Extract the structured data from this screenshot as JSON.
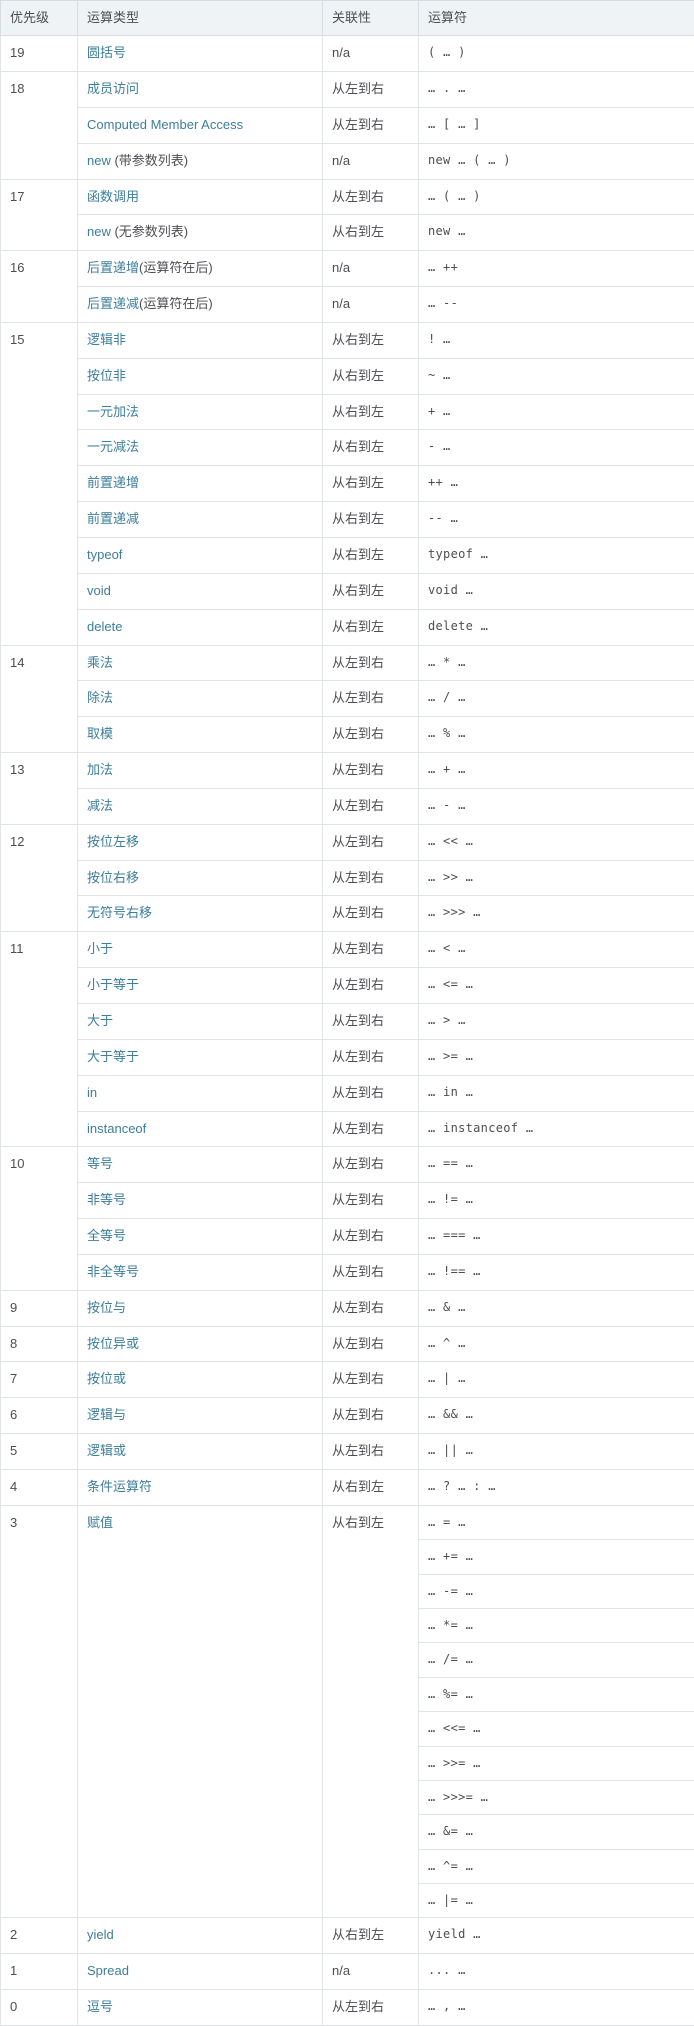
{
  "table": {
    "headers": [
      "优先级",
      "运算类型",
      "关联性",
      "运算符"
    ],
    "assoc": {
      "na": "n/a",
      "ltr": "从左到右",
      "rtl": "从右到左"
    },
    "rows": [
      {
        "precedence": "19",
        "precedence_rowspan": 1,
        "type_link": "圆括号",
        "type_note": "",
        "assoc": "n/a",
        "operator": "( … )"
      },
      {
        "precedence": "18",
        "precedence_rowspan": 3,
        "type_link": "成员访问",
        "type_note": "",
        "assoc": "从左到右",
        "operator": "… . …"
      },
      {
        "precedence": "",
        "precedence_rowspan": 0,
        "type_link": "Computed Member Access",
        "type_note": "",
        "assoc": "从左到右",
        "operator": "… [ … ]"
      },
      {
        "precedence": "",
        "precedence_rowspan": 0,
        "type_link": "new",
        "type_note": " (带参数列表)",
        "assoc": "n/a",
        "operator": "new … ( … )"
      },
      {
        "precedence": "17",
        "precedence_rowspan": 2,
        "type_link": "函数调用",
        "type_note": "",
        "assoc": "从左到右",
        "operator": "… ( … )"
      },
      {
        "precedence": "",
        "precedence_rowspan": 0,
        "type_link": "new",
        "type_note": " (无参数列表)",
        "assoc": "从右到左",
        "operator": "new …"
      },
      {
        "precedence": "16",
        "precedence_rowspan": 2,
        "type_link": "后置递增",
        "type_note": "(运算符在后)",
        "assoc": "n/a",
        "operator": "… ++"
      },
      {
        "precedence": "",
        "precedence_rowspan": 0,
        "type_link": "后置递减",
        "type_note": "(运算符在后)",
        "assoc": "n/a",
        "operator": "… --"
      },
      {
        "precedence": "15",
        "precedence_rowspan": 9,
        "type_link": "逻辑非",
        "type_note": "",
        "assoc": "从右到左",
        "operator": "! …"
      },
      {
        "precedence": "",
        "precedence_rowspan": 0,
        "type_link": "按位非",
        "type_note": "",
        "assoc": "从右到左",
        "operator": "~ …"
      },
      {
        "precedence": "",
        "precedence_rowspan": 0,
        "type_link": "一元加法",
        "type_note": "",
        "assoc": "从右到左",
        "operator": "+ …"
      },
      {
        "precedence": "",
        "precedence_rowspan": 0,
        "type_link": "一元减法",
        "type_note": "",
        "assoc": "从右到左",
        "operator": "- …"
      },
      {
        "precedence": "",
        "precedence_rowspan": 0,
        "type_link": "前置递增",
        "type_note": "",
        "assoc": "从右到左",
        "operator": "++ …"
      },
      {
        "precedence": "",
        "precedence_rowspan": 0,
        "type_link": "前置递减",
        "type_note": "",
        "assoc": "从右到左",
        "operator": "-- …"
      },
      {
        "precedence": "",
        "precedence_rowspan": 0,
        "type_link": "typeof",
        "type_note": "",
        "assoc": "从右到左",
        "operator": "typeof …"
      },
      {
        "precedence": "",
        "precedence_rowspan": 0,
        "type_link": "void",
        "type_note": "",
        "assoc": "从右到左",
        "operator": "void …"
      },
      {
        "precedence": "",
        "precedence_rowspan": 0,
        "type_link": "delete",
        "type_note": "",
        "assoc": "从右到左",
        "operator": "delete …"
      },
      {
        "precedence": "14",
        "precedence_rowspan": 3,
        "type_link": "乘法",
        "type_note": "",
        "assoc": "从左到右",
        "operator": "… * …"
      },
      {
        "precedence": "",
        "precedence_rowspan": 0,
        "type_link": "除法",
        "type_note": "",
        "assoc": "从左到右",
        "operator": "… / …"
      },
      {
        "precedence": "",
        "precedence_rowspan": 0,
        "type_link": "取模",
        "type_note": "",
        "assoc": "从左到右",
        "operator": "… % …"
      },
      {
        "precedence": "13",
        "precedence_rowspan": 2,
        "type_link": "加法",
        "type_note": "",
        "assoc": "从左到右",
        "operator": "… + …"
      },
      {
        "precedence": "",
        "precedence_rowspan": 0,
        "type_link": "减法",
        "type_note": "",
        "assoc": "从左到右",
        "operator": "… - …"
      },
      {
        "precedence": "12",
        "precedence_rowspan": 3,
        "type_link": "按位左移",
        "type_note": "",
        "assoc": "从左到右",
        "operator": "… << …"
      },
      {
        "precedence": "",
        "precedence_rowspan": 0,
        "type_link": "按位右移",
        "type_note": "",
        "assoc": "从左到右",
        "operator": "… >> …"
      },
      {
        "precedence": "",
        "precedence_rowspan": 0,
        "type_link": "无符号右移",
        "type_note": "",
        "assoc": "从左到右",
        "operator": "… >>> …"
      },
      {
        "precedence": "11",
        "precedence_rowspan": 6,
        "type_link": "小于",
        "type_note": "",
        "assoc": "从左到右",
        "operator": "… < …"
      },
      {
        "precedence": "",
        "precedence_rowspan": 0,
        "type_link": "小于等于",
        "type_note": "",
        "assoc": "从左到右",
        "operator": "… <= …"
      },
      {
        "precedence": "",
        "precedence_rowspan": 0,
        "type_link": "大于",
        "type_note": "",
        "assoc": "从左到右",
        "operator": "… > …"
      },
      {
        "precedence": "",
        "precedence_rowspan": 0,
        "type_link": "大于等于",
        "type_note": "",
        "assoc": "从左到右",
        "operator": "… >= …"
      },
      {
        "precedence": "",
        "precedence_rowspan": 0,
        "type_link": "in",
        "type_note": "",
        "assoc": "从左到右",
        "operator": "… in …"
      },
      {
        "precedence": "",
        "precedence_rowspan": 0,
        "type_link": "instanceof",
        "type_note": "",
        "assoc": "从左到右",
        "operator": "… instanceof …"
      },
      {
        "precedence": "10",
        "precedence_rowspan": 4,
        "type_link": "等号",
        "type_note": "",
        "assoc": "从左到右",
        "operator": "… == …"
      },
      {
        "precedence": "",
        "precedence_rowspan": 0,
        "type_link": "非等号",
        "type_note": "",
        "assoc": "从左到右",
        "operator": "… != …"
      },
      {
        "precedence": "",
        "precedence_rowspan": 0,
        "type_link": "全等号",
        "type_note": "",
        "assoc": "从左到右",
        "operator": "… === …"
      },
      {
        "precedence": "",
        "precedence_rowspan": 0,
        "type_link": "非全等号",
        "type_note": "",
        "assoc": "从左到右",
        "operator": "… !== …"
      },
      {
        "precedence": "9",
        "precedence_rowspan": 1,
        "type_link": "按位与",
        "type_note": "",
        "assoc": "从左到右",
        "operator": "… & …"
      },
      {
        "precedence": "8",
        "precedence_rowspan": 1,
        "type_link": "按位异或",
        "type_note": "",
        "assoc": "从左到右",
        "operator": "… ^ …"
      },
      {
        "precedence": "7",
        "precedence_rowspan": 1,
        "type_link": "按位或",
        "type_note": "",
        "assoc": "从左到右",
        "operator": "… | …"
      },
      {
        "precedence": "6",
        "precedence_rowspan": 1,
        "type_link": "逻辑与",
        "type_note": "",
        "assoc": "从左到右",
        "operator": "… && …"
      },
      {
        "precedence": "5",
        "precedence_rowspan": 1,
        "type_link": "逻辑或",
        "type_note": "",
        "assoc": "从左到右",
        "operator": "… || …"
      },
      {
        "precedence": "4",
        "precedence_rowspan": 1,
        "type_link": "条件运算符",
        "type_note": "",
        "assoc": "从右到左",
        "operator": "… ? … : …"
      },
      {
        "precedence": "3",
        "precedence_rowspan": 12,
        "type_link": "赋值",
        "type_note": "",
        "type_rowspan": 12,
        "assoc": "从右到左",
        "assoc_rowspan": 12,
        "operator": "… = …"
      },
      {
        "precedence": "",
        "precedence_rowspan": 0,
        "type_rowspan": 0,
        "assoc_rowspan": 0,
        "type_link": "",
        "type_note": "",
        "assoc": "",
        "operator": "… += …"
      },
      {
        "precedence": "",
        "precedence_rowspan": 0,
        "type_rowspan": 0,
        "assoc_rowspan": 0,
        "type_link": "",
        "type_note": "",
        "assoc": "",
        "operator": "… -= …"
      },
      {
        "precedence": "",
        "precedence_rowspan": 0,
        "type_rowspan": 0,
        "assoc_rowspan": 0,
        "type_link": "",
        "type_note": "",
        "assoc": "",
        "operator": "… *= …"
      },
      {
        "precedence": "",
        "precedence_rowspan": 0,
        "type_rowspan": 0,
        "assoc_rowspan": 0,
        "type_link": "",
        "type_note": "",
        "assoc": "",
        "operator": "… /= …"
      },
      {
        "precedence": "",
        "precedence_rowspan": 0,
        "type_rowspan": 0,
        "assoc_rowspan": 0,
        "type_link": "",
        "type_note": "",
        "assoc": "",
        "operator": "… %= …"
      },
      {
        "precedence": "",
        "precedence_rowspan": 0,
        "type_rowspan": 0,
        "assoc_rowspan": 0,
        "type_link": "",
        "type_note": "",
        "assoc": "",
        "operator": "… <<= …"
      },
      {
        "precedence": "",
        "precedence_rowspan": 0,
        "type_rowspan": 0,
        "assoc_rowspan": 0,
        "type_link": "",
        "type_note": "",
        "assoc": "",
        "operator": "… >>= …"
      },
      {
        "precedence": "",
        "precedence_rowspan": 0,
        "type_rowspan": 0,
        "assoc_rowspan": 0,
        "type_link": "",
        "type_note": "",
        "assoc": "",
        "operator": "… >>>= …"
      },
      {
        "precedence": "",
        "precedence_rowspan": 0,
        "type_rowspan": 0,
        "assoc_rowspan": 0,
        "type_link": "",
        "type_note": "",
        "assoc": "",
        "operator": "… &= …"
      },
      {
        "precedence": "",
        "precedence_rowspan": 0,
        "type_rowspan": 0,
        "assoc_rowspan": 0,
        "type_link": "",
        "type_note": "",
        "assoc": "",
        "operator": "… ^= …"
      },
      {
        "precedence": "",
        "precedence_rowspan": 0,
        "type_rowspan": 0,
        "assoc_rowspan": 0,
        "type_link": "",
        "type_note": "",
        "assoc": "",
        "operator": "… |= …"
      },
      {
        "precedence": "2",
        "precedence_rowspan": 1,
        "type_link": "yield",
        "type_note": "",
        "assoc": "从右到左",
        "operator": "yield …"
      },
      {
        "precedence": "1",
        "precedence_rowspan": 1,
        "type_link": "Spread",
        "type_note": "",
        "assoc": "n/a",
        "operator": "... …"
      },
      {
        "precedence": "0",
        "precedence_rowspan": 1,
        "type_link": "逗号",
        "type_note": "",
        "assoc": "从左到右",
        "operator": "… , …"
      }
    ]
  }
}
